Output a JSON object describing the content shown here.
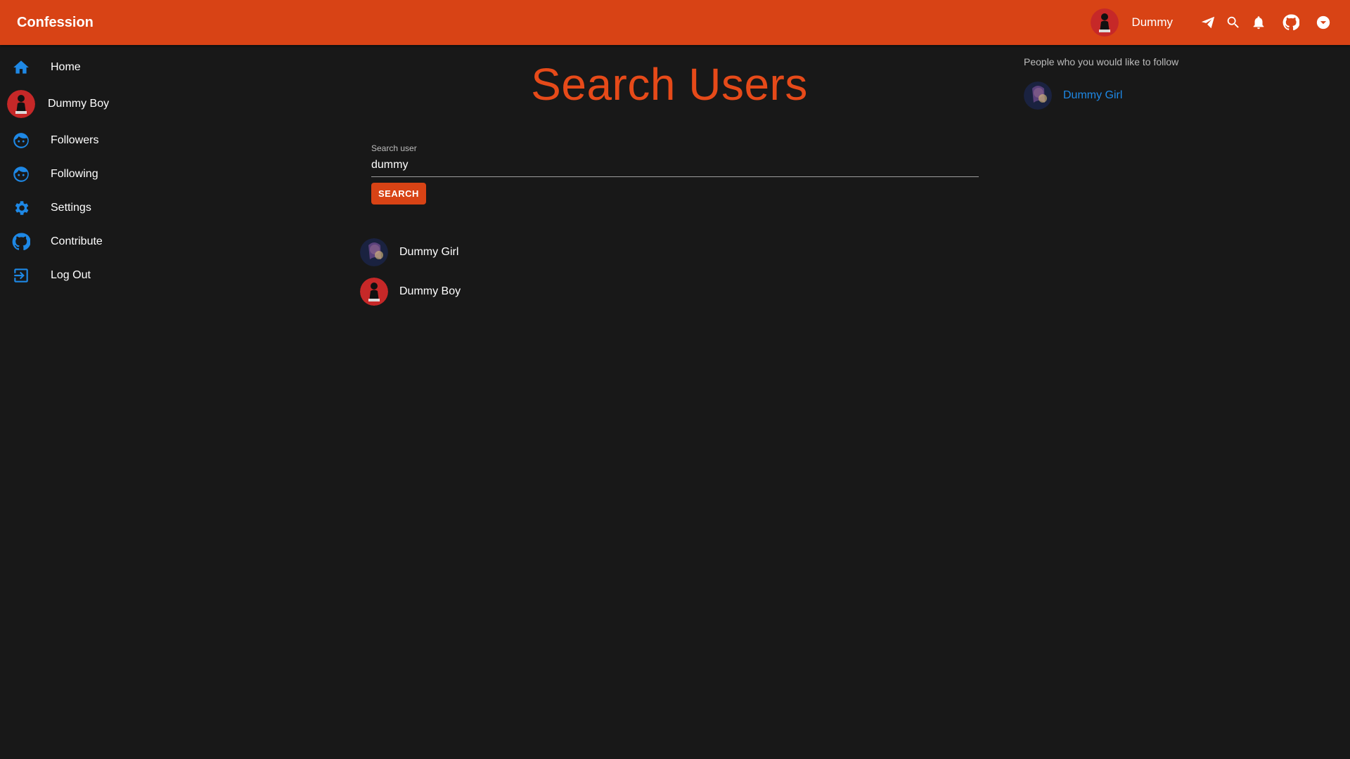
{
  "appbar": {
    "title": "Confession",
    "user_name": "Dummy",
    "icons": [
      "send-icon",
      "search-icon",
      "notifications-icon",
      "github-icon",
      "chevron-down-icon"
    ]
  },
  "sidebar": {
    "items": [
      {
        "label": "Home",
        "icon": "home-icon"
      },
      {
        "label": "Dummy Boy",
        "icon": "avatar"
      },
      {
        "label": "Followers",
        "icon": "face-icon"
      },
      {
        "label": "Following",
        "icon": "face-icon"
      },
      {
        "label": "Settings",
        "icon": "gear-icon"
      },
      {
        "label": "Contribute",
        "icon": "github-icon"
      },
      {
        "label": "Log Out",
        "icon": "logout-icon"
      }
    ]
  },
  "main": {
    "title": "Search Users",
    "search": {
      "label": "Search user",
      "value": "dummy",
      "button_label": "SEARCH"
    },
    "results": [
      {
        "name": "Dummy Girl"
      },
      {
        "name": "Dummy Boy"
      }
    ]
  },
  "suggestions": {
    "title": "People who you would like to follow",
    "items": [
      {
        "name": "Dummy Girl"
      }
    ]
  },
  "colors": {
    "appbar": "#d84315",
    "accent": "#e64a19",
    "link": "#1e88e5",
    "background": "#181818"
  }
}
